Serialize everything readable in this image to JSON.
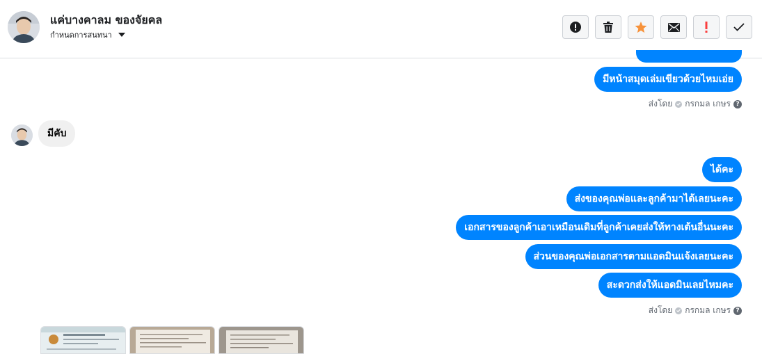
{
  "header": {
    "contact_name": "แค่บางคาลม ของจัยคล",
    "conversation_settings": "กำหนดการสนทนา"
  },
  "toolbar": {
    "buttons": [
      {
        "name": "report-button",
        "icon": "alert-circle-icon"
      },
      {
        "name": "delete-button",
        "icon": "trash-icon"
      },
      {
        "name": "star-button",
        "icon": "star-icon",
        "color": "#f7923a"
      },
      {
        "name": "mark-unread-button",
        "icon": "envelope-icon"
      },
      {
        "name": "important-button",
        "icon": "exclamation-icon",
        "color": "#fa3e3e"
      },
      {
        "name": "done-button",
        "icon": "checkmark-icon"
      }
    ]
  },
  "messages": {
    "outgoing_group_1": [
      "มีหน้าสมุดเล่มเขียวด้วยไหมเอ่ย"
    ],
    "incoming_1": "มีคับ",
    "outgoing_group_2": [
      "ได้คะ",
      "ส่งของคุณพ่อและลูกค้ามาได้เลยนะคะ",
      "เอกสารของลูกค้าเอาเหมือนเดิมที่ลูกค้าเคยส่งให้ทางเต้นอื่นนะคะ",
      "ส่วนของคุณพ่อเอกสารตามแอดมินแจ้งเลยนะคะ",
      "สะดวกส่งให้แอดมินเลยไหมคะ"
    ]
  },
  "sent_by": {
    "label": "ส่งโดย",
    "sender": "กรกมล เกษร",
    "help": "?"
  },
  "colors": {
    "bubble_out": "#0084ff",
    "bubble_in": "#f0f0f0",
    "divider": "#dadde1"
  }
}
